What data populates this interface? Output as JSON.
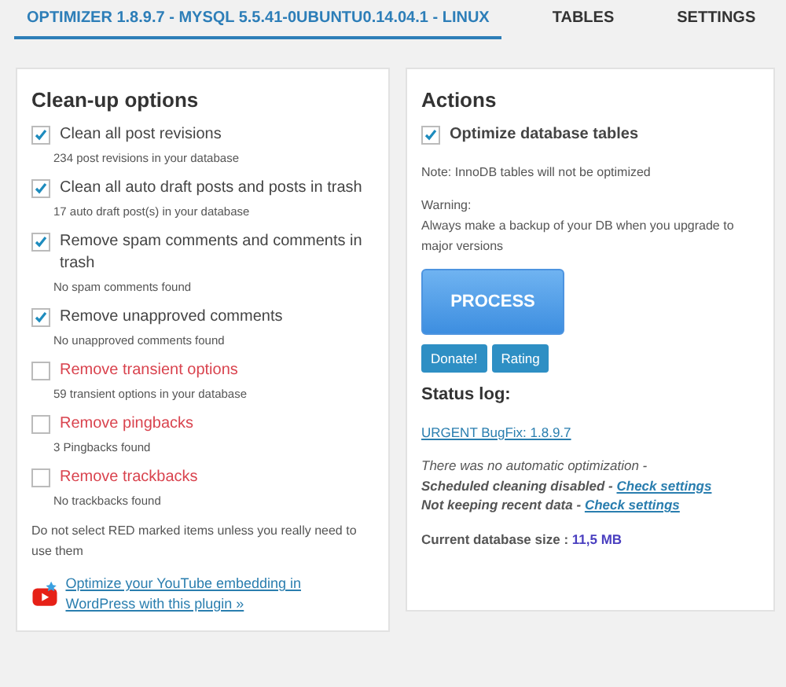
{
  "tabs": [
    {
      "label": "OPTIMIZER 1.8.9.7 - MYSQL 5.5.41-0UBUNTU0.14.04.1 - LINUX",
      "selected": true
    },
    {
      "label": "TABLES",
      "selected": false
    },
    {
      "label": "SETTINGS",
      "selected": false
    }
  ],
  "cleanup": {
    "title": "Clean-up options",
    "options": [
      {
        "label": "Clean all post revisions",
        "note": "234 post revisions in your database",
        "checked": true,
        "danger": false
      },
      {
        "label": "Clean all auto draft posts and posts in trash",
        "note": "17 auto draft post(s) in your database",
        "checked": true,
        "danger": false
      },
      {
        "label": "Remove spam comments and comments in trash",
        "note": "No spam comments found",
        "checked": true,
        "danger": false
      },
      {
        "label": "Remove unapproved comments",
        "note": "No unapproved comments found",
        "checked": true,
        "danger": false
      },
      {
        "label": "Remove transient options",
        "note": "59 transient options in your database",
        "checked": false,
        "danger": true
      },
      {
        "label": "Remove pingbacks",
        "note": "3 Pingbacks found",
        "checked": false,
        "danger": true
      },
      {
        "label": "Remove trackbacks",
        "note": "No trackbacks found",
        "checked": false,
        "danger": true
      }
    ],
    "warning": "Do not select RED marked items unless you really need to use them",
    "promo_link": "Optimize your YouTube embedding in WordPress with this plugin »"
  },
  "actions": {
    "title": "Actions",
    "optimize": {
      "label": "Optimize database tables",
      "checked": true
    },
    "note_label": "Note:",
    "note": "InnoDB tables will not be optimized",
    "warning_label": "Warning:",
    "warning": "Always make a backup of your DB when you upgrade to major versions",
    "process_button": "PROCESS",
    "buttons": [
      "Donate!",
      "Rating"
    ]
  },
  "status": {
    "title": "Status log:",
    "link": "URGENT BugFix: 1.8.9.7",
    "lines": [
      {
        "text": "There was no automatic optimization -",
        "bold": false
      },
      {
        "text": "Scheduled cleaning disabled -",
        "bold": true,
        "link": "Check settings"
      },
      {
        "text": "Not keeping recent data -",
        "bold": true,
        "link": "Check settings"
      }
    ],
    "size_label": "Current database size :",
    "size": "11,5 MB"
  }
}
